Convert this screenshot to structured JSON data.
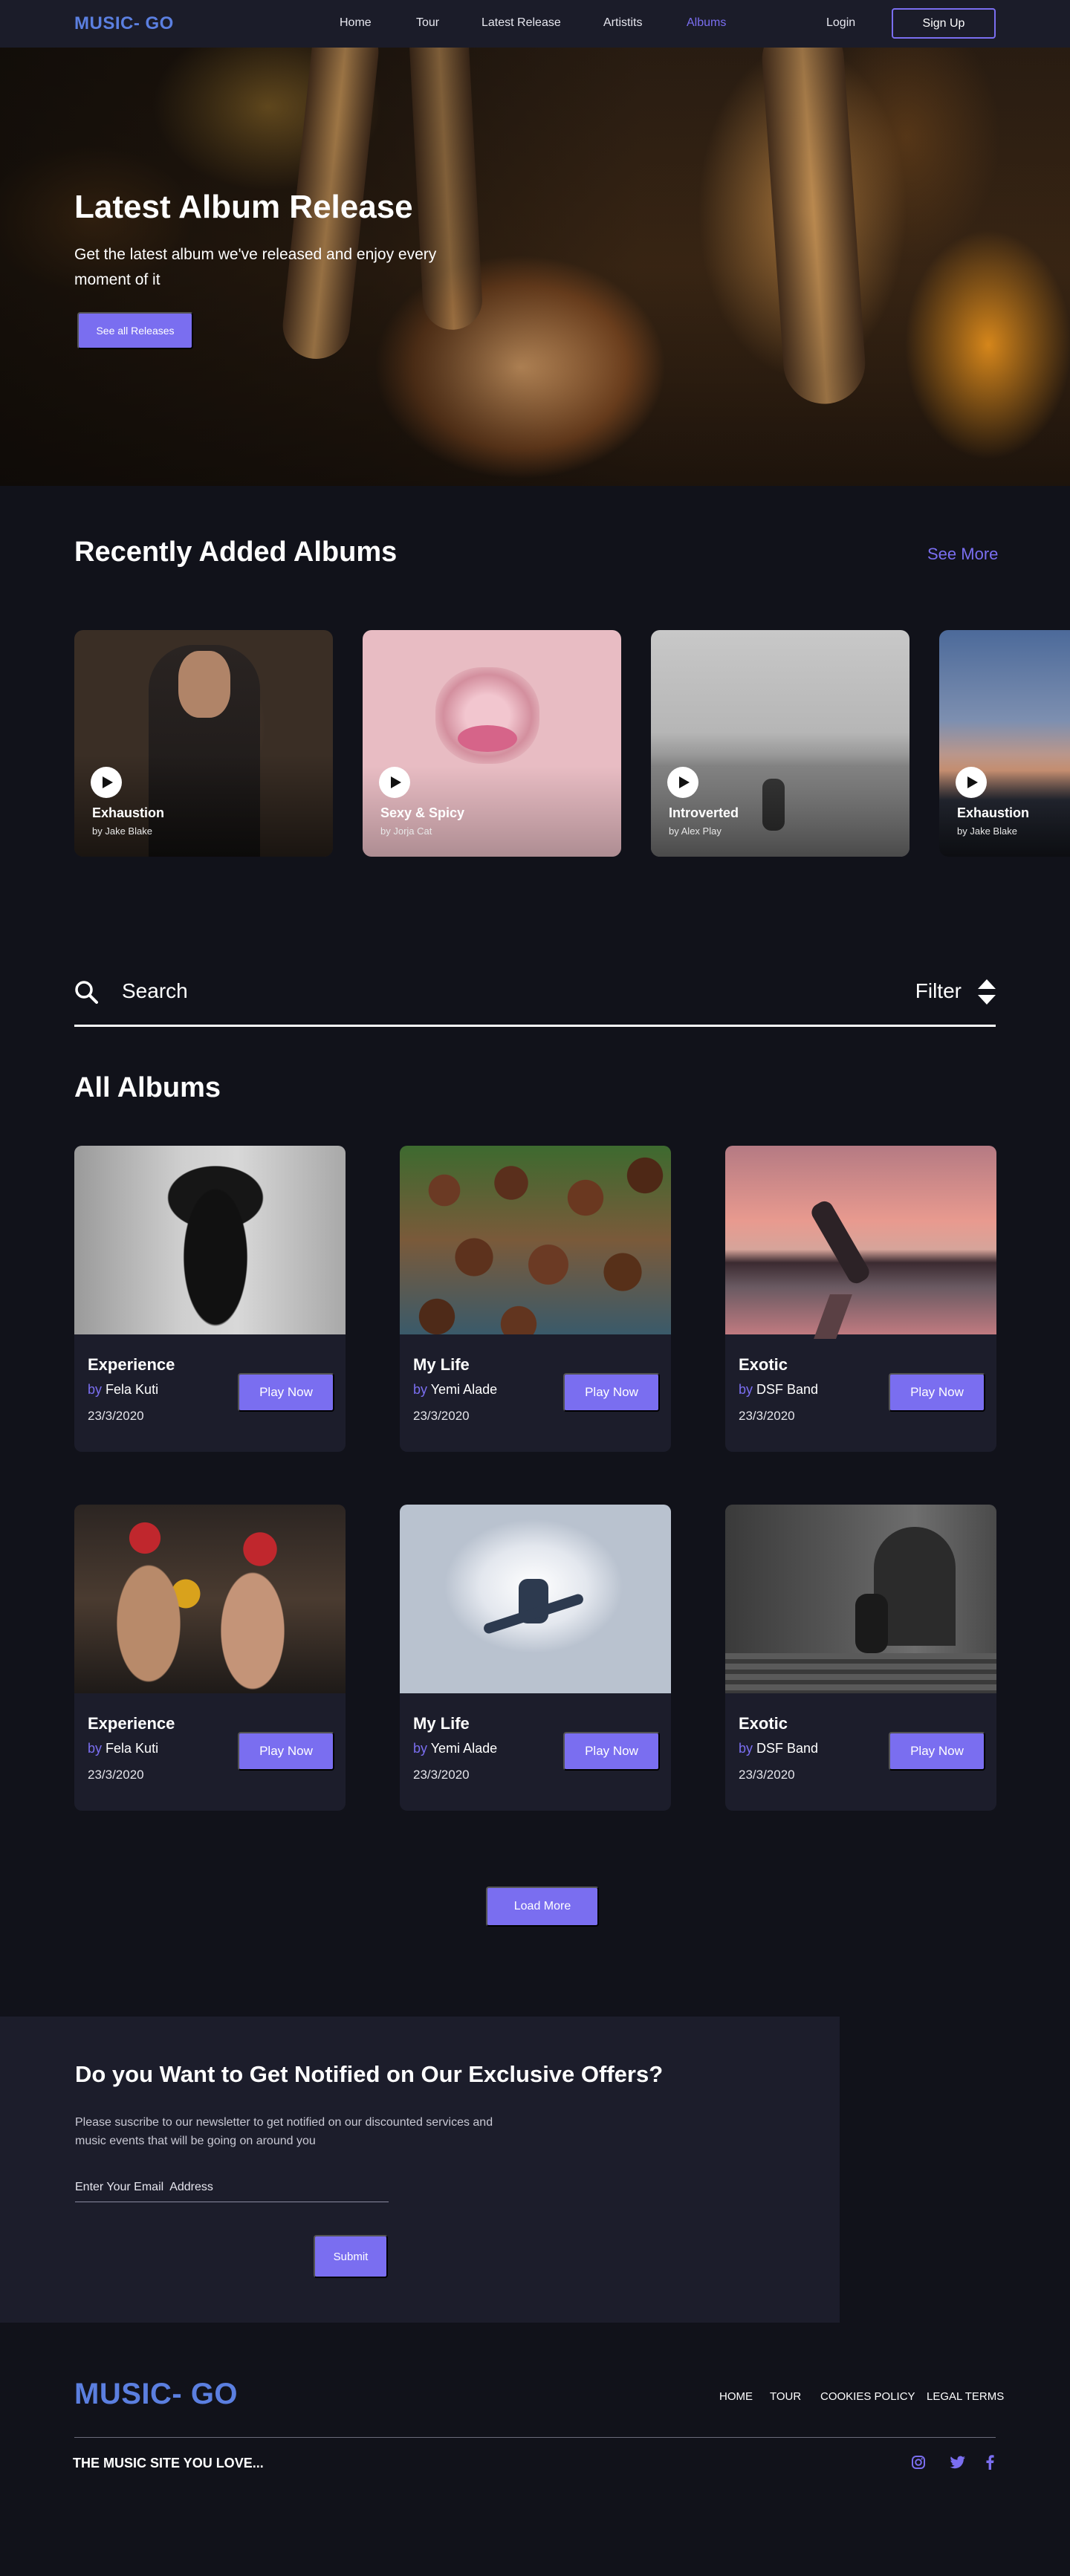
{
  "nav": {
    "logo": "MUSIC- GO",
    "links": [
      "Home",
      "Tour",
      "Latest Release",
      "Artistits",
      "Albums"
    ],
    "active": "Albums",
    "login": "Login",
    "signup": "Sign Up"
  },
  "hero": {
    "title": "Latest Album Release",
    "subtitle": "Get the latest album  we've released and enjoy every moment of it",
    "button": "See all Releases"
  },
  "recent": {
    "title": "Recently Added Albums",
    "see_more": "See More",
    "items": [
      {
        "title": "Exhaustion",
        "by": "by",
        "artist": "Jake Blake"
      },
      {
        "title": "Sexy & Spicy",
        "by": "by",
        "artist": "Jorja Cat"
      },
      {
        "title": "Introverted",
        "by": "by",
        "artist": "Alex Play"
      },
      {
        "title": "Exhaustion",
        "by": "by",
        "artist": "Jake Blake"
      }
    ]
  },
  "search": {
    "placeholder": "Search",
    "filter": "Filter"
  },
  "albums": {
    "title": "All Albums",
    "play_label": "Play Now",
    "by": "by",
    "items": [
      {
        "title": "Experience",
        "artist": "Fela Kuti",
        "date": "23/3/2020"
      },
      {
        "title": "My Life",
        "artist": "Yemi Alade",
        "date": "23/3/2020"
      },
      {
        "title": "Exotic",
        "artist": "DSF Band",
        "date": "23/3/2020"
      },
      {
        "title": "Experience",
        "artist": "Fela Kuti",
        "date": "23/3/2020"
      },
      {
        "title": "My Life",
        "artist": "Yemi Alade",
        "date": "23/3/2020"
      },
      {
        "title": "Exotic",
        "artist": "DSF Band",
        "date": "23/3/2020"
      }
    ],
    "load_more": "Load More"
  },
  "newsletter": {
    "title": "Do you Want to Get Notified on Our Exclusive Offers?",
    "description": "Please suscribe to our newsletter to get  notified on our  discounted services and music events that will be going on around you",
    "email_placeholder": "Enter Your Email  Address",
    "submit": "Submit"
  },
  "footer": {
    "logo": "MUSIC- GO",
    "links": [
      "HOME",
      "TOUR",
      "COOKIES POLICY",
      "LEGAL TERMS"
    ],
    "tagline": "THE MUSIC SITE YOU LOVE...",
    "social": [
      "instagram-icon",
      "twitter-icon",
      "facebook-icon"
    ]
  },
  "colors": {
    "accent": "#7a6ef0",
    "logo": "#5b7fe0",
    "background": "#11121a",
    "panel": "#1c1d2b"
  }
}
